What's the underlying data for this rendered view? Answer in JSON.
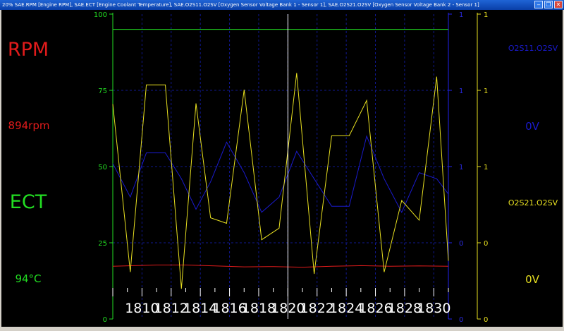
{
  "window": {
    "title": "20% SAE.RPM [Engine RPM], SAE.ECT [Engine Coolant Temperature], SAE.O2S11.O2SV [Oxygen Sensor Voltage Bank 1 - Sensor 1], SAE.O2S21.O2SV [Oxygen Sensor Voltage Bank 2 - Sensor 1]"
  },
  "left_panel": {
    "rpm_name": "RPM",
    "rpm_value": "894rpm",
    "ect_name": "ECT",
    "ect_value": "94°C"
  },
  "right_panel": {
    "o2s11_name": "O2S11.O2SV",
    "o2s11_value": "0V",
    "o2s21_name": "O2S21.O2SV",
    "o2s21_value": "0V"
  },
  "colors": {
    "rpm": "#e01b1b",
    "ect": "#22dd22",
    "o2s11": "#1a1acc",
    "o2s21": "#e8e020",
    "cursor": "#ffffff"
  },
  "chart_data": {
    "type": "line",
    "left_axis_ticks": [
      "100",
      "75",
      "50",
      "25",
      "0"
    ],
    "blue_axis_ticks": [
      "1",
      "1",
      "1",
      "0",
      "0"
    ],
    "yellow_axis_ticks": [
      "1",
      "1",
      "1",
      "0",
      "0"
    ],
    "x_tick_labels": [
      "1810",
      "1812",
      "1814",
      "1816",
      "1818",
      "1820",
      "1822",
      "1824",
      "1826",
      "1828",
      "1830"
    ],
    "series": [
      {
        "key": "ect",
        "ylim": [
          0,
          100
        ],
        "points": [
          [
            1808,
            95
          ],
          [
            1831,
            95
          ]
        ]
      },
      {
        "key": "rpm",
        "ylim": [
          0,
          100
        ],
        "points": [
          [
            1808,
            17.3
          ],
          [
            1811,
            17.7
          ],
          [
            1813,
            17.7
          ],
          [
            1815,
            17.4
          ],
          [
            1817,
            17.1
          ],
          [
            1819,
            17.2
          ],
          [
            1821,
            17.0
          ],
          [
            1823,
            17.3
          ],
          [
            1825,
            17.5
          ],
          [
            1827,
            17.3
          ],
          [
            1829,
            17.4
          ],
          [
            1831,
            17.3
          ]
        ]
      },
      {
        "key": "o2s11",
        "ylim": [
          0,
          100
        ],
        "points": [
          [
            1808,
            51
          ],
          [
            1809.2,
            40
          ],
          [
            1810.3,
            54.5
          ],
          [
            1811.6,
            54.5
          ],
          [
            1812.7,
            46
          ],
          [
            1813.7,
            36
          ],
          [
            1814.7,
            45
          ],
          [
            1815.8,
            58
          ],
          [
            1817,
            48
          ],
          [
            1818.2,
            35
          ],
          [
            1819.4,
            40
          ],
          [
            1820.6,
            55
          ],
          [
            1821.8,
            46
          ],
          [
            1823,
            37
          ],
          [
            1824.2,
            37
          ],
          [
            1825.4,
            60
          ],
          [
            1826.6,
            46
          ],
          [
            1827.8,
            35
          ],
          [
            1829,
            48
          ],
          [
            1830.2,
            46
          ],
          [
            1831,
            41
          ]
        ]
      },
      {
        "key": "o2s21",
        "ylim": [
          0,
          100
        ],
        "points": [
          [
            1808,
            70.5
          ],
          [
            1809.2,
            15.4
          ],
          [
            1810.3,
            76.8
          ],
          [
            1811.6,
            76.8
          ],
          [
            1812.7,
            9.9
          ],
          [
            1813.7,
            70.7
          ],
          [
            1814.7,
            33.2
          ],
          [
            1815.8,
            31.4
          ],
          [
            1817,
            75.2
          ],
          [
            1818.2,
            26
          ],
          [
            1819.4,
            29.8
          ],
          [
            1820.6,
            80.7
          ],
          [
            1821.8,
            14.8
          ],
          [
            1823,
            60.1
          ],
          [
            1824.2,
            60.1
          ],
          [
            1825.4,
            71.7
          ],
          [
            1826.6,
            15.4
          ],
          [
            1827.8,
            38.9
          ],
          [
            1829,
            32.4
          ],
          [
            1830.2,
            79.5
          ],
          [
            1831,
            19.1
          ]
        ]
      }
    ],
    "cursor_x": 1820
  }
}
